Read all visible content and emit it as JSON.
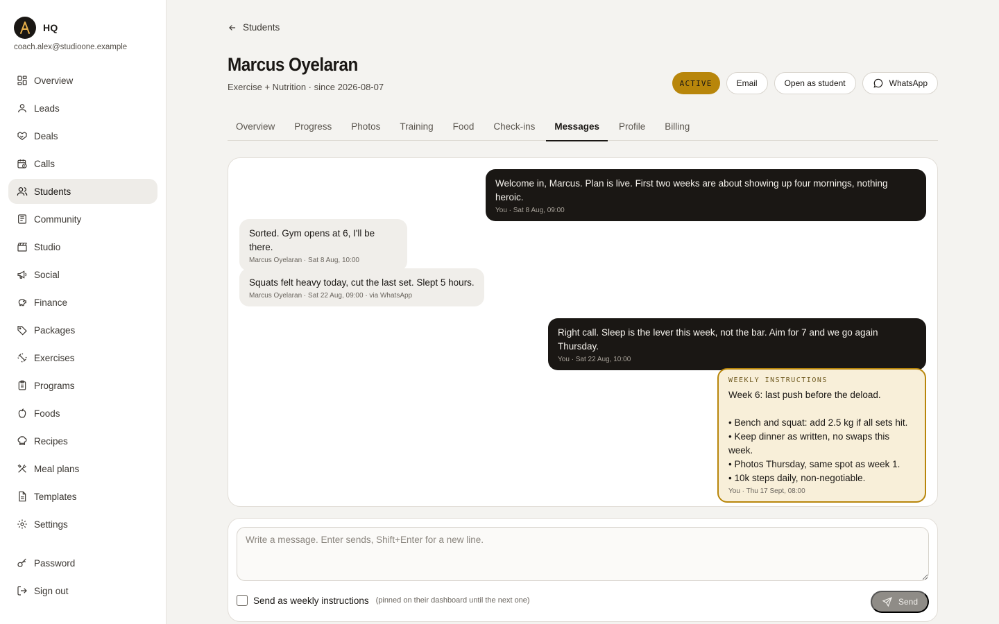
{
  "brand": {
    "name": "HQ",
    "logo_letter": "A",
    "email": "coach.alex@studioone.example",
    "logo_bg": "#1a1714",
    "logo_fg": "#e8b04a"
  },
  "nav": [
    {
      "label": "Overview",
      "icon": "grid-icon"
    },
    {
      "label": "Leads",
      "icon": "user-icon"
    },
    {
      "label": "Deals",
      "icon": "handshake-icon"
    },
    {
      "label": "Calls",
      "icon": "calendar-clock-icon"
    },
    {
      "label": "Students",
      "icon": "users-icon",
      "active": true
    },
    {
      "label": "Community",
      "icon": "newspaper-icon"
    },
    {
      "label": "Studio",
      "icon": "clapperboard-icon"
    },
    {
      "label": "Social",
      "icon": "megaphone-icon"
    },
    {
      "label": "Finance",
      "icon": "piggy-bank-icon"
    },
    {
      "label": "Packages",
      "icon": "tag-icon"
    },
    {
      "label": "Exercises",
      "icon": "dumbbell-icon"
    },
    {
      "label": "Programs",
      "icon": "clipboard-list-icon"
    },
    {
      "label": "Foods",
      "icon": "apple-icon"
    },
    {
      "label": "Recipes",
      "icon": "chef-hat-icon"
    },
    {
      "label": "Meal plans",
      "icon": "utensils-crossed-icon"
    },
    {
      "label": "Templates",
      "icon": "file-text-icon"
    },
    {
      "label": "Settings",
      "icon": "gear-icon"
    }
  ],
  "nav_bottom": [
    {
      "label": "Password",
      "icon": "key-icon"
    },
    {
      "label": "Sign out",
      "icon": "log-out-icon"
    }
  ],
  "header": {
    "back_label": "Students",
    "student_name": "Marcus Oyelaran",
    "subtitle": "Exercise + Nutrition · since 2026-08-07",
    "status_badge": "ACTIVE",
    "email_button": "Email",
    "open_as_student_button": "Open as student",
    "whatsapp_button": "WhatsApp"
  },
  "tabs": [
    "Overview",
    "Progress",
    "Photos",
    "Training",
    "Food",
    "Check-ins",
    "Messages",
    "Profile",
    "Billing"
  ],
  "active_tab": "Messages",
  "messages": [
    {
      "direction": "out",
      "text": "Welcome in, Marcus. Plan is live. First two weeks are about showing up four mornings, nothing heroic.",
      "meta": "You · Sat 8 Aug, 09:00"
    },
    {
      "direction": "in",
      "text": "Sorted. Gym opens at 6, I'll be there.",
      "meta": "Marcus Oyelaran · Sat 8 Aug, 10:00"
    },
    {
      "direction": "in",
      "text": "Squats felt heavy today, cut the last set. Slept 5 hours.",
      "meta": "Marcus Oyelaran · Sat 22 Aug, 09:00 · via WhatsApp"
    },
    {
      "direction": "out",
      "text": "Right call. Sleep is the lever this week, not the bar. Aim for 7 and we go again Thursday.",
      "meta": "You · Sat 22 Aug, 10:00"
    },
    {
      "direction": "pinned",
      "label": "WEEKLY INSTRUCTIONS",
      "text": "Week 6: last push before the deload.\n\n• Bench and squat: add 2.5 kg if all sets hit.\n• Keep dinner as written, no swaps this week.\n• Photos Thursday, same spot as week 1.\n• 10k steps daily, non-negotiable.",
      "meta": "You · Thu 17 Sept, 08:00"
    }
  ],
  "composer": {
    "placeholder": "Write a message. Enter sends, Shift+Enter for a new line.",
    "value": "",
    "weekly_label": "Send as weekly instructions",
    "weekly_hint": "(pinned on their dashboard until the next one)",
    "weekly_checked": false,
    "send_label": "Send"
  },
  "colors": {
    "accent": "#b8860b",
    "dark": "#1a1714",
    "pinned_bg": "#f8efd9"
  }
}
